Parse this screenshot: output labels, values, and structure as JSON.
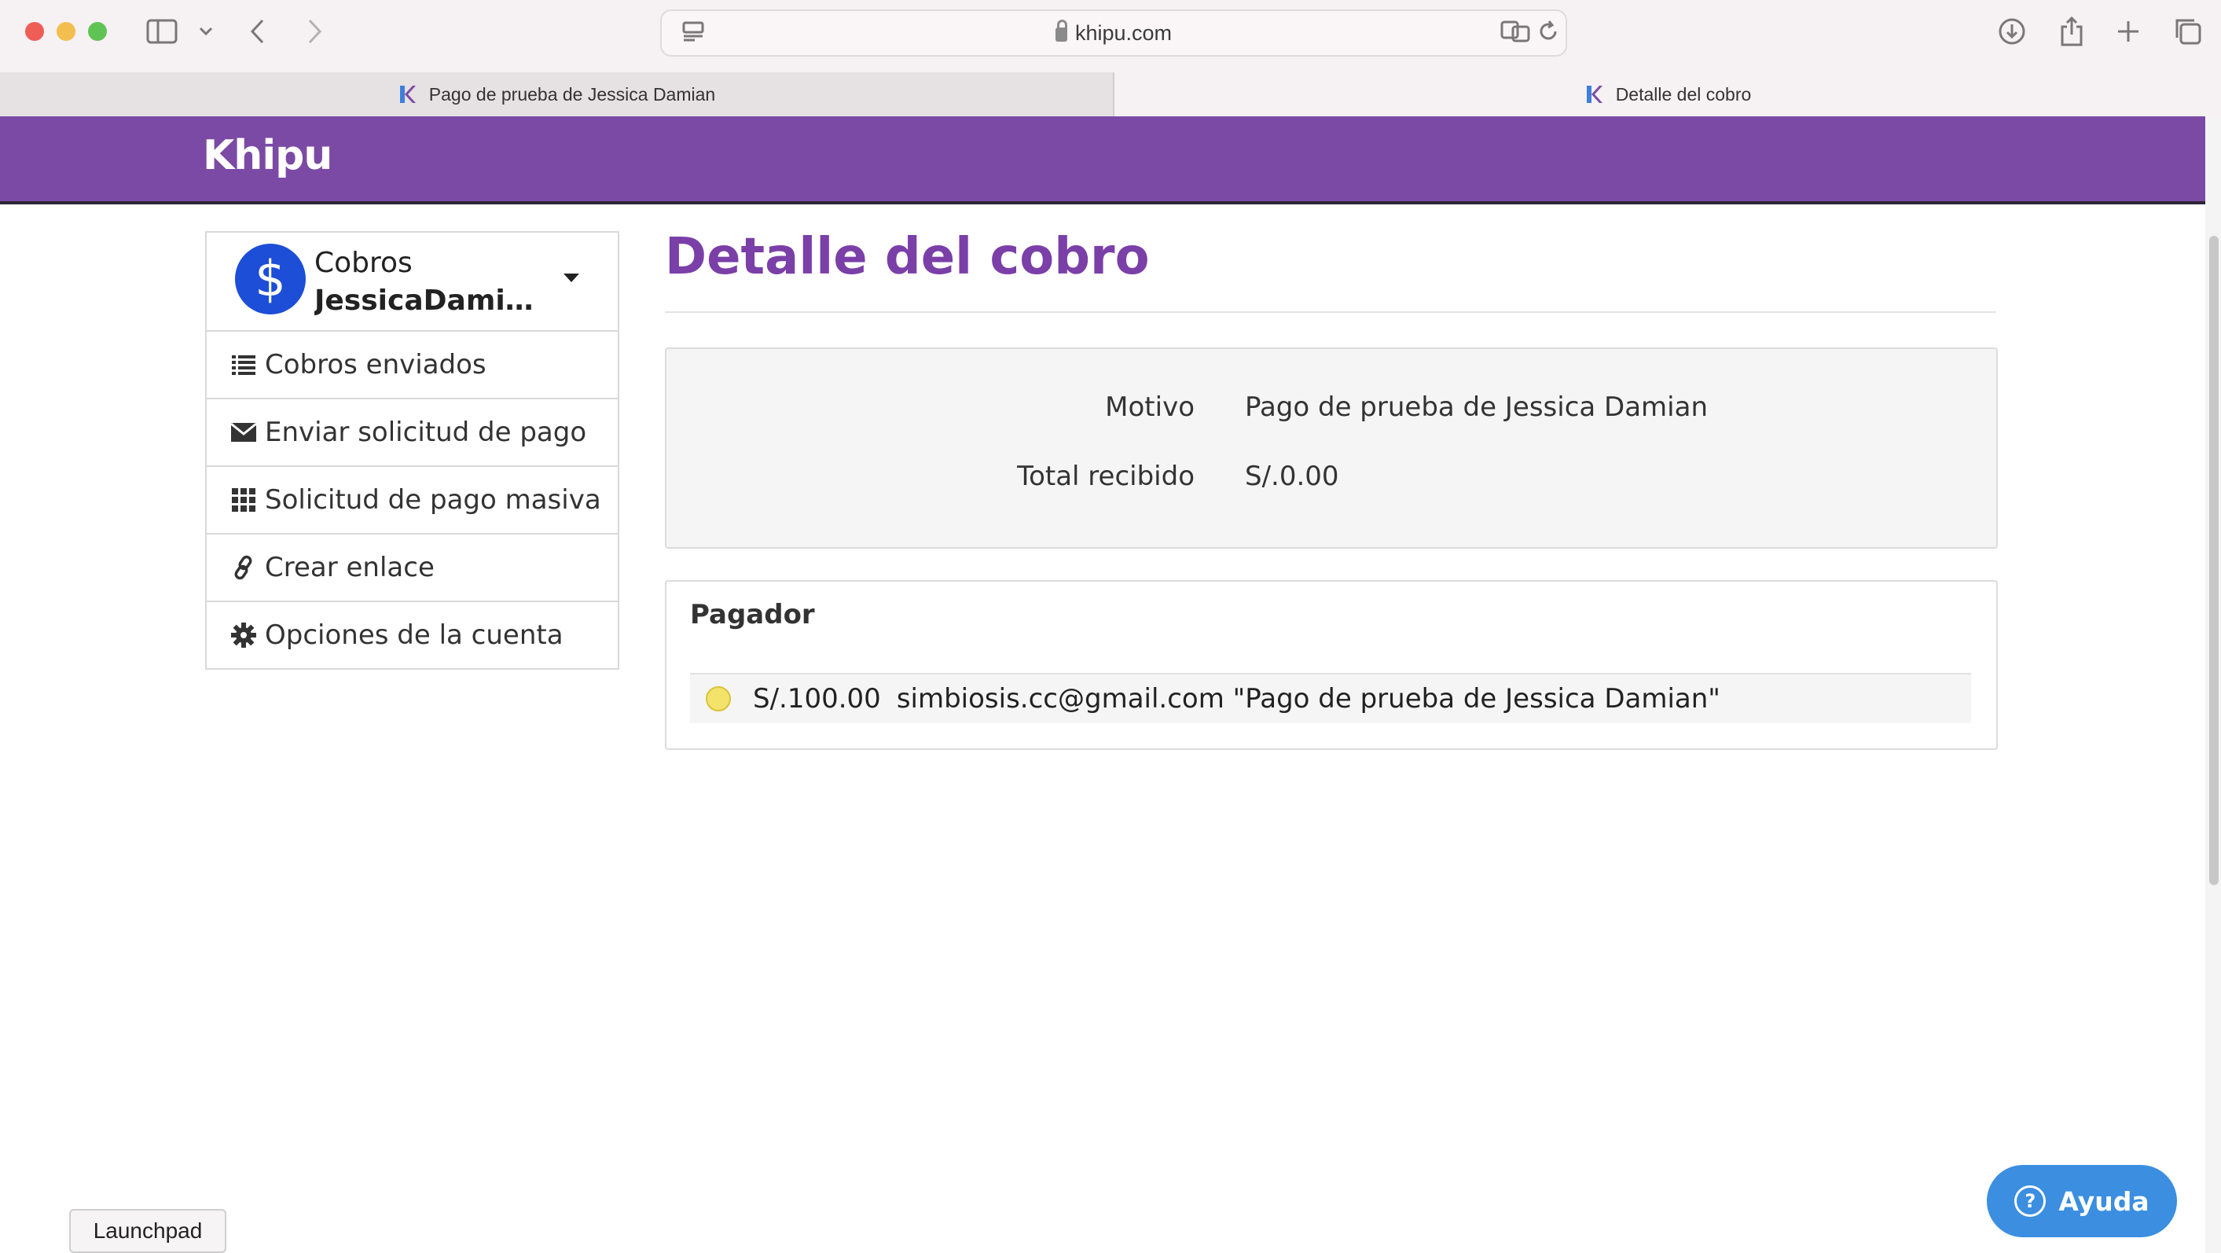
{
  "browser": {
    "url": "khipu.com",
    "tabs": [
      {
        "title": "Pago de prueba de Jessica Damian",
        "active": false
      },
      {
        "title": "Detalle del cobro",
        "active": true
      }
    ]
  },
  "header": {
    "logo_text": "Khipu",
    "brand_color": "#7b4aa5"
  },
  "sidebar": {
    "account": {
      "label": "Cobros",
      "name": "JessicaDamia...",
      "avatar_symbol": "$"
    },
    "items": [
      {
        "label": "Cobros enviados",
        "icon": "list-icon"
      },
      {
        "label": "Enviar solicitud de pago",
        "icon": "envelope-icon"
      },
      {
        "label": "Solicitud de pago masiva",
        "icon": "grid-icon"
      },
      {
        "label": "Crear enlace",
        "icon": "link-icon"
      },
      {
        "label": "Opciones de la cuenta",
        "icon": "gear-icon"
      }
    ]
  },
  "main": {
    "title": "Detalle del cobro",
    "summary": {
      "motivo_label": "Motivo",
      "motivo_value": "Pago de prueba de Jessica Damian",
      "total_label": "Total recibido",
      "total_value": "S/.0.00"
    },
    "payer": {
      "heading": "Pagador",
      "rows": [
        {
          "status_color": "#f3e36b",
          "amount": "S/.100.00",
          "detail": "simbiosis.cc@gmail.com \"Pago de prueba de Jessica Damian\""
        }
      ]
    }
  },
  "help_button": {
    "label": "Ayuda",
    "icon": "question-icon"
  },
  "dock_tooltip": "Launchpad"
}
